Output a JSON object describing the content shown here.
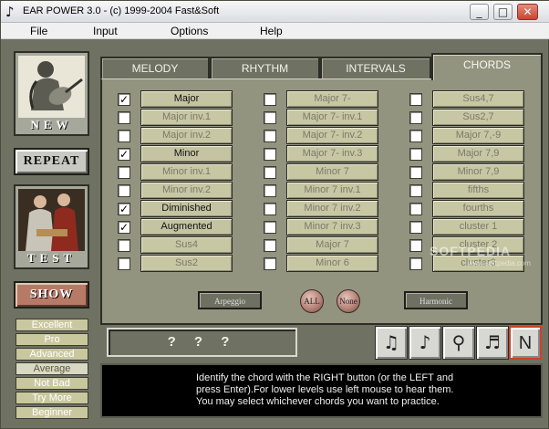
{
  "window": {
    "title": "EAR POWER 3.0  -  (c) 1999-2004 Fast&Soft",
    "app_icon": "music-note-icon",
    "controls": {
      "minimize": "_",
      "maximize": "□",
      "close": "✕"
    }
  },
  "menu": [
    "File",
    "Input",
    "Options",
    "Help"
  ],
  "left": {
    "new_label": "NEW",
    "repeat_label": "REPEAT",
    "test_label": "TEST",
    "show_label": "SHOW",
    "levels": [
      "Excellent",
      "Pro",
      "Advanced",
      "Average",
      "Not Bad",
      "Try More",
      "Beginner"
    ],
    "selected_level": "Average"
  },
  "tabs": [
    "MELODY",
    "RHYTHM",
    "INTERVALS",
    "CHORDS"
  ],
  "active_tab": "CHORDS",
  "chords": {
    "col1": [
      {
        "label": "Major",
        "checked": true
      },
      {
        "label": "Major inv.1",
        "checked": false
      },
      {
        "label": "Major inv.2",
        "checked": false
      },
      {
        "label": "Minor",
        "checked": true
      },
      {
        "label": "Minor inv.1",
        "checked": false
      },
      {
        "label": "Minor inv.2",
        "checked": false
      },
      {
        "label": "Diminished",
        "checked": true
      },
      {
        "label": "Augmented",
        "checked": true
      },
      {
        "label": "Sus4",
        "checked": false
      },
      {
        "label": "Sus2",
        "checked": false
      }
    ],
    "col2": [
      {
        "label": "Major 7-",
        "checked": false
      },
      {
        "label": "Major 7- inv.1",
        "checked": false
      },
      {
        "label": "Major 7- inv.2",
        "checked": false
      },
      {
        "label": "Major 7- inv.3",
        "checked": false
      },
      {
        "label": "Minor 7",
        "checked": false
      },
      {
        "label": "Minor 7 inv.1",
        "checked": false
      },
      {
        "label": "Minor 7 inv.2",
        "checked": false
      },
      {
        "label": "Minor 7 inv.3",
        "checked": false
      },
      {
        "label": "Major 7",
        "checked": false
      },
      {
        "label": "Minor 6",
        "checked": false
      }
    ],
    "col3": [
      {
        "label": "Sus4,7",
        "checked": false
      },
      {
        "label": "Sus2,7",
        "checked": false
      },
      {
        "label": "Major 7,-9",
        "checked": false
      },
      {
        "label": "Major 7,9",
        "checked": false
      },
      {
        "label": "Minor 7,9",
        "checked": false
      },
      {
        "label": "fifths",
        "checked": false
      },
      {
        "label": "fourths",
        "checked": false
      },
      {
        "label": "cluster 1",
        "checked": false
      },
      {
        "label": "cluster 2",
        "checked": false
      },
      {
        "label": "cluster3",
        "checked": false
      }
    ],
    "check_mark": "✓"
  },
  "mode_buttons": {
    "arpeggio": "Arpeggio",
    "all": "ALL",
    "none": "None",
    "harmonic": "Harmonic"
  },
  "question": "? ? ?",
  "instruments": [
    {
      "icon": "piano-icon",
      "glyph": "♫"
    },
    {
      "icon": "guitar-icon",
      "glyph": "♪"
    },
    {
      "icon": "microphone-icon",
      "glyph": "⚲"
    },
    {
      "icon": "sheet-music-icon",
      "glyph": "♬"
    },
    {
      "icon": "notation-n-icon",
      "glyph": "N"
    }
  ],
  "info_lines": [
    "Identify the chord with the RIGHT button (or the LEFT and",
    "press Enter).For lower levels use left mouse to hear them.",
    "You may select whichever chords you want to practice."
  ],
  "watermark": {
    "main": "SOFTPEDIA",
    "sub": "www.softpedia.com"
  }
}
